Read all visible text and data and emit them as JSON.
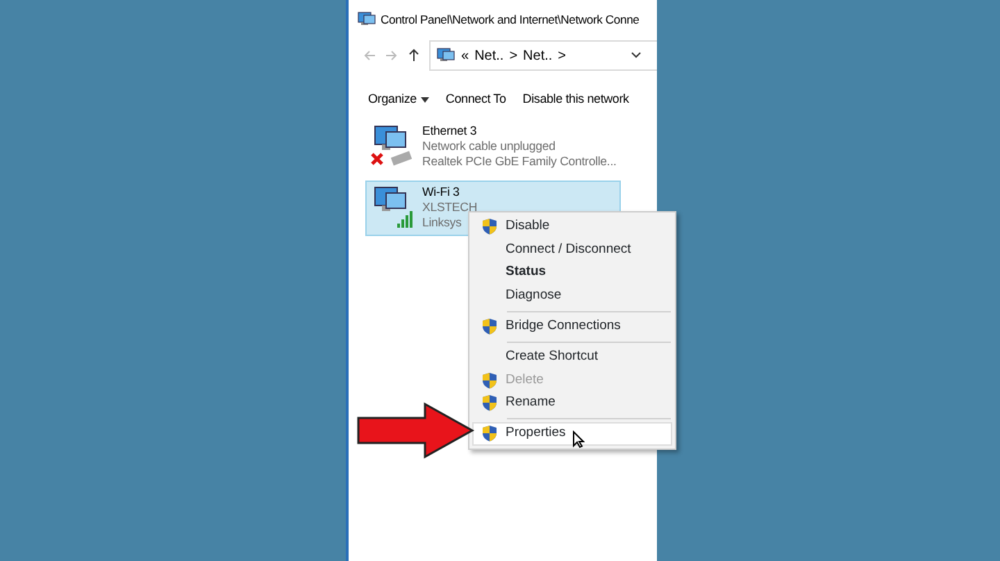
{
  "window": {
    "title": "Control Panel\\Network and Internet\\Network Conne"
  },
  "address_bar": {
    "prefix": "«",
    "crumbs": [
      {
        "label": "Net.."
      },
      {
        "label": "Net.."
      }
    ],
    "separator": ">"
  },
  "toolbar": [
    {
      "label": "Organize",
      "dropdown": true
    },
    {
      "label": "Connect To",
      "dropdown": false
    },
    {
      "label": "Disable this network",
      "dropdown": false
    }
  ],
  "connections": [
    {
      "kind": "ethernet",
      "name": "Ethernet 3",
      "status": "Network cable unplugged",
      "device": "Realtek PCIe GbE Family Controlle...",
      "selected": false
    },
    {
      "kind": "wifi",
      "name": "Wi-Fi 3",
      "status": "XLSTECH",
      "device": "Linksys",
      "selected": true
    }
  ],
  "context_menu": [
    {
      "label": "Disable",
      "shield": true,
      "bold": false,
      "disabled": false,
      "selected": false,
      "separator_after": false
    },
    {
      "label": "Connect / Disconnect",
      "shield": false,
      "bold": false,
      "disabled": false,
      "selected": false,
      "separator_after": false
    },
    {
      "label": "Status",
      "shield": false,
      "bold": true,
      "disabled": false,
      "selected": false,
      "separator_after": false
    },
    {
      "label": "Diagnose",
      "shield": false,
      "bold": false,
      "disabled": false,
      "selected": false,
      "separator_after": true
    },
    {
      "label": "Bridge Connections",
      "shield": true,
      "bold": false,
      "disabled": false,
      "selected": false,
      "separator_after": true
    },
    {
      "label": "Create Shortcut",
      "shield": false,
      "bold": false,
      "disabled": false,
      "selected": false,
      "separator_after": false
    },
    {
      "label": "Delete",
      "shield": true,
      "bold": false,
      "disabled": true,
      "selected": false,
      "separator_after": false
    },
    {
      "label": "Rename",
      "shield": true,
      "bold": false,
      "disabled": false,
      "selected": false,
      "separator_after": true
    },
    {
      "label": "Properties",
      "shield": true,
      "bold": false,
      "disabled": false,
      "selected": true,
      "separator_after": false
    }
  ]
}
